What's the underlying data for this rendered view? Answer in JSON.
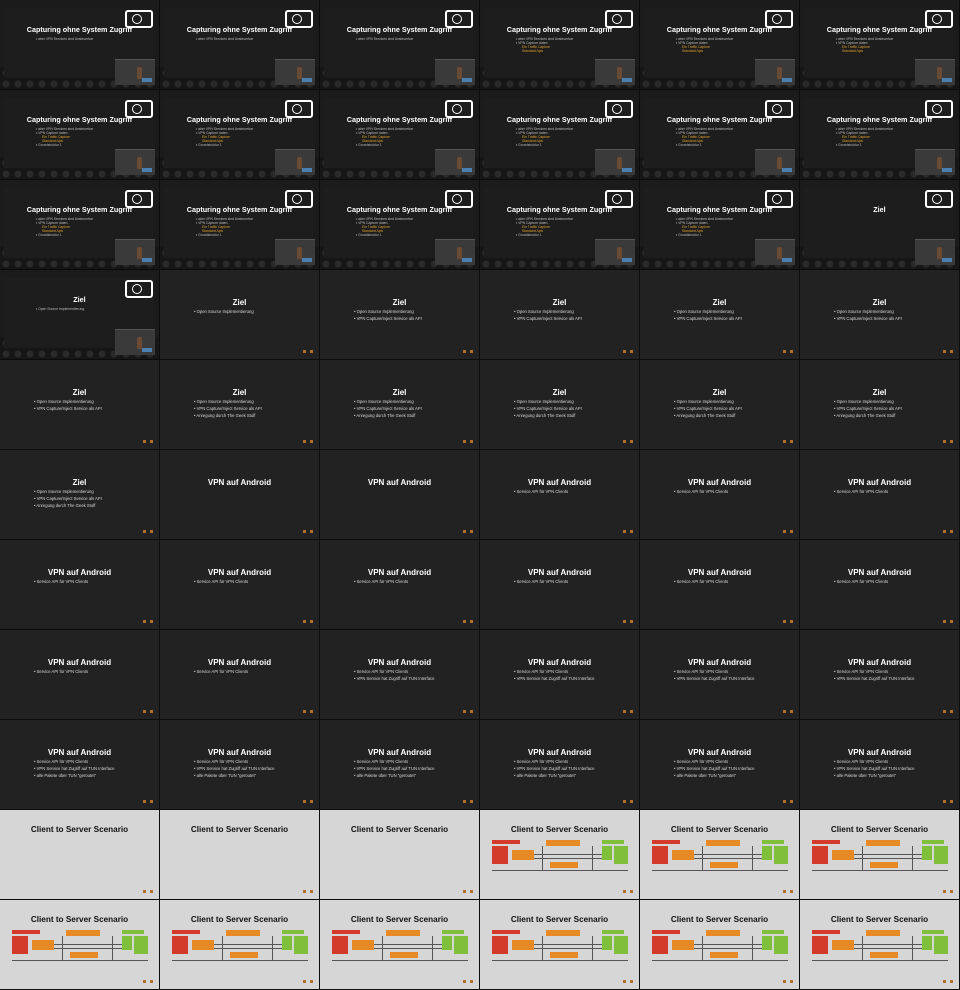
{
  "strings": {
    "capturing": "Capturing ohne System Zugriff",
    "ziel": "Ziel",
    "vpn": "VPN auf Android",
    "client_server": "Client to Server Scenario"
  },
  "bullets": {
    "cap1": "aber VPN Services sind Ansteuerbar",
    "cap2": "VPN Capture daten",
    "cap2a": "Ein Traffic Capture",
    "cap2b": "Standard Apis",
    "cap3": "Grundstruktur 1",
    "ziel1": "Open Source Implementierung",
    "ziel2": "VPN Capture/Inject Service als API",
    "ziel3": "Anregung durch The Geek Stuff",
    "vpn1": "Service API für VPN Clients",
    "vpn2": "VPN Service hat Zugriff auf TUN Interface",
    "vpn3": "alle Pakete über TUN \"geroutet\""
  },
  "colors": {
    "accent": "#e0a030",
    "red": "#d43a2a",
    "orange": "#e58a24",
    "green": "#7fbf3a"
  },
  "icons": {
    "logo": "conference-logo-icon",
    "camera": "speaker-camera-icon",
    "nav": "slide-nav-dots-icon"
  },
  "tiles": [
    {
      "type": "venue",
      "title": "capturing",
      "bullets": [
        "cap1"
      ]
    },
    {
      "type": "venue",
      "title": "capturing",
      "bullets": [
        "cap1"
      ]
    },
    {
      "type": "venue",
      "title": "capturing",
      "bullets": [
        "cap1"
      ]
    },
    {
      "type": "venue",
      "title": "capturing",
      "bullets": [
        "cap1",
        "cap2",
        "cap2a",
        "cap2b"
      ]
    },
    {
      "type": "venue",
      "title": "capturing",
      "bullets": [
        "cap1",
        "cap2",
        "cap2a",
        "cap2b"
      ]
    },
    {
      "type": "venue",
      "title": "capturing",
      "bullets": [
        "cap1",
        "cap2",
        "cap2a",
        "cap2b"
      ]
    },
    {
      "type": "venue",
      "title": "capturing",
      "bullets": [
        "cap1",
        "cap2",
        "cap2a",
        "cap2b",
        "cap3"
      ]
    },
    {
      "type": "venue",
      "title": "capturing",
      "bullets": [
        "cap1",
        "cap2",
        "cap2a",
        "cap2b",
        "cap3"
      ]
    },
    {
      "type": "venue",
      "title": "capturing",
      "bullets": [
        "cap1",
        "cap2",
        "cap2a",
        "cap2b",
        "cap3"
      ]
    },
    {
      "type": "venue",
      "title": "capturing",
      "bullets": [
        "cap1",
        "cap2",
        "cap2a",
        "cap2b",
        "cap3"
      ]
    },
    {
      "type": "venue",
      "title": "capturing",
      "bullets": [
        "cap1",
        "cap2",
        "cap2a",
        "cap2b",
        "cap3"
      ]
    },
    {
      "type": "venue",
      "title": "capturing",
      "bullets": [
        "cap1",
        "cap2",
        "cap2a",
        "cap2b",
        "cap3"
      ]
    },
    {
      "type": "venue",
      "title": "capturing",
      "bullets": [
        "cap1",
        "cap2",
        "cap2a",
        "cap2b",
        "cap3"
      ]
    },
    {
      "type": "venue",
      "title": "capturing",
      "bullets": [
        "cap1",
        "cap2",
        "cap2a",
        "cap2b",
        "cap3"
      ]
    },
    {
      "type": "venue",
      "title": "capturing",
      "bullets": [
        "cap1",
        "cap2",
        "cap2a",
        "cap2b",
        "cap3"
      ]
    },
    {
      "type": "venue",
      "title": "capturing",
      "bullets": [
        "cap1",
        "cap2",
        "cap2a",
        "cap2b",
        "cap3"
      ]
    },
    {
      "type": "venue",
      "title": "capturing",
      "bullets": [
        "cap1",
        "cap2",
        "cap2a",
        "cap2b",
        "cap3"
      ]
    },
    {
      "type": "venue",
      "title": "ziel",
      "bullets": []
    },
    {
      "type": "venue",
      "title": "ziel",
      "bullets": [
        "ziel1"
      ]
    },
    {
      "type": "dark",
      "title": "ziel",
      "bullets": [
        "ziel1"
      ]
    },
    {
      "type": "dark",
      "title": "ziel",
      "bullets": [
        "ziel1",
        "ziel2"
      ]
    },
    {
      "type": "dark",
      "title": "ziel",
      "bullets": [
        "ziel1",
        "ziel2"
      ]
    },
    {
      "type": "dark",
      "title": "ziel",
      "bullets": [
        "ziel1",
        "ziel2"
      ]
    },
    {
      "type": "dark",
      "title": "ziel",
      "bullets": [
        "ziel1",
        "ziel2"
      ]
    },
    {
      "type": "dark",
      "title": "ziel",
      "bullets": [
        "ziel1",
        "ziel2"
      ]
    },
    {
      "type": "dark",
      "title": "ziel",
      "bullets": [
        "ziel1",
        "ziel2",
        "ziel3"
      ]
    },
    {
      "type": "dark",
      "title": "ziel",
      "bullets": [
        "ziel1",
        "ziel2",
        "ziel3"
      ]
    },
    {
      "type": "dark",
      "title": "ziel",
      "bullets": [
        "ziel1",
        "ziel2",
        "ziel3"
      ]
    },
    {
      "type": "dark",
      "title": "ziel",
      "bullets": [
        "ziel1",
        "ziel2",
        "ziel3"
      ]
    },
    {
      "type": "dark",
      "title": "ziel",
      "bullets": [
        "ziel1",
        "ziel2",
        "ziel3"
      ]
    },
    {
      "type": "dark",
      "title": "ziel",
      "bullets": [
        "ziel1",
        "ziel2",
        "ziel3"
      ]
    },
    {
      "type": "dark",
      "title": "vpn",
      "bullets": []
    },
    {
      "type": "dark",
      "title": "vpn",
      "bullets": []
    },
    {
      "type": "dark",
      "title": "vpn",
      "bullets": [
        "vpn1"
      ]
    },
    {
      "type": "dark",
      "title": "vpn",
      "bullets": [
        "vpn1"
      ]
    },
    {
      "type": "dark",
      "title": "vpn",
      "bullets": [
        "vpn1"
      ]
    },
    {
      "type": "dark",
      "title": "vpn",
      "bullets": [
        "vpn1"
      ]
    },
    {
      "type": "dark",
      "title": "vpn",
      "bullets": [
        "vpn1"
      ]
    },
    {
      "type": "dark",
      "title": "vpn",
      "bullets": [
        "vpn1"
      ]
    },
    {
      "type": "dark",
      "title": "vpn",
      "bullets": [
        "vpn1"
      ]
    },
    {
      "type": "dark",
      "title": "vpn",
      "bullets": [
        "vpn1"
      ]
    },
    {
      "type": "dark",
      "title": "vpn",
      "bullets": [
        "vpn1"
      ]
    },
    {
      "type": "dark",
      "title": "vpn",
      "bullets": [
        "vpn1"
      ]
    },
    {
      "type": "dark",
      "title": "vpn",
      "bullets": [
        "vpn1"
      ]
    },
    {
      "type": "dark",
      "title": "vpn",
      "bullets": [
        "vpn1",
        "vpn2"
      ]
    },
    {
      "type": "dark",
      "title": "vpn",
      "bullets": [
        "vpn1",
        "vpn2"
      ]
    },
    {
      "type": "dark",
      "title": "vpn",
      "bullets": [
        "vpn1",
        "vpn2"
      ]
    },
    {
      "type": "dark",
      "title": "vpn",
      "bullets": [
        "vpn1",
        "vpn2"
      ]
    },
    {
      "type": "dark",
      "title": "vpn",
      "bullets": [
        "vpn1",
        "vpn2",
        "vpn3"
      ]
    },
    {
      "type": "dark",
      "title": "vpn",
      "bullets": [
        "vpn1",
        "vpn2",
        "vpn3"
      ]
    },
    {
      "type": "dark",
      "title": "vpn",
      "bullets": [
        "vpn1",
        "vpn2",
        "vpn3"
      ]
    },
    {
      "type": "dark",
      "title": "vpn",
      "bullets": [
        "vpn1",
        "vpn2",
        "vpn3"
      ]
    },
    {
      "type": "dark",
      "title": "vpn",
      "bullets": [
        "vpn1",
        "vpn2",
        "vpn3"
      ]
    },
    {
      "type": "dark",
      "title": "vpn",
      "bullets": [
        "vpn1",
        "vpn2",
        "vpn3"
      ]
    },
    {
      "type": "light",
      "title": "client_server",
      "diagram": false
    },
    {
      "type": "light",
      "title": "client_server",
      "diagram": false
    },
    {
      "type": "light",
      "title": "client_server",
      "diagram": false
    },
    {
      "type": "light",
      "title": "client_server",
      "diagram": true
    },
    {
      "type": "light",
      "title": "client_server",
      "diagram": true
    },
    {
      "type": "light",
      "title": "client_server",
      "diagram": true
    },
    {
      "type": "light",
      "title": "client_server",
      "diagram": true
    },
    {
      "type": "light",
      "title": "client_server",
      "diagram": true
    },
    {
      "type": "light",
      "title": "client_server",
      "diagram": true
    },
    {
      "type": "light",
      "title": "client_server",
      "diagram": true
    },
    {
      "type": "light",
      "title": "client_server",
      "diagram": true
    },
    {
      "type": "light",
      "title": "client_server",
      "diagram": true
    }
  ]
}
